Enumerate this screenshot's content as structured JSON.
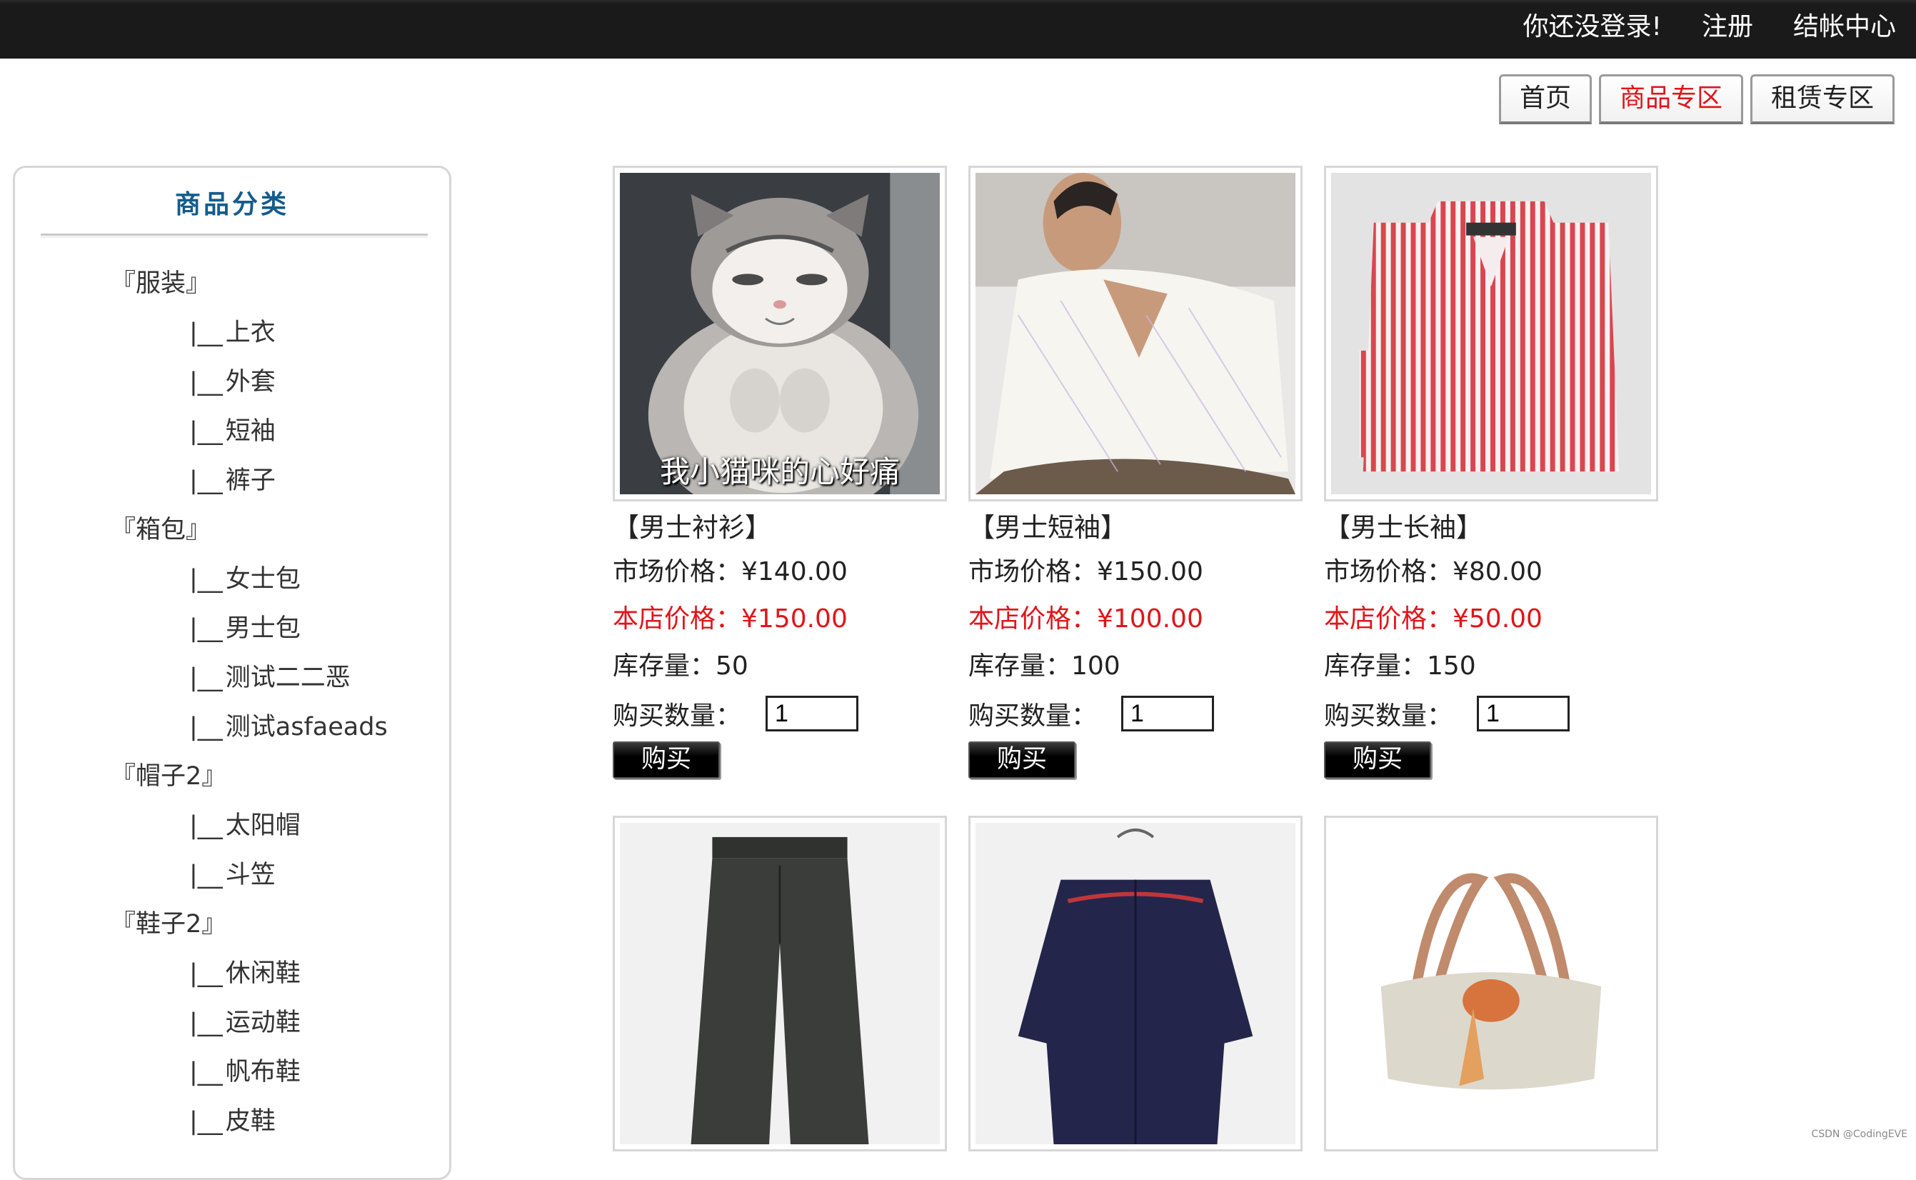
{
  "header": {
    "login_status": "你还没登录!",
    "register": "注册",
    "checkout": "结帐中心"
  },
  "tabs": [
    {
      "label": "首页",
      "active": false
    },
    {
      "label": "商品专区",
      "active": true
    },
    {
      "label": "租赁专区",
      "active": false
    }
  ],
  "sidebar": {
    "title": "商品分类",
    "categories": [
      {
        "name": "『服装』",
        "children": [
          "上衣",
          "外套",
          "短袖",
          "裤子"
        ]
      },
      {
        "name": "『箱包』",
        "children": [
          "女士包",
          "男士包",
          "测试二二恶",
          "测试asfaeads"
        ]
      },
      {
        "name": "『帽子2』",
        "children": [
          "太阳帽",
          "斗笠"
        ]
      },
      {
        "name": "『鞋子2』",
        "children": [
          "休闲鞋",
          "运动鞋",
          "帆布鞋",
          "皮鞋"
        ]
      }
    ],
    "branch_glyph": "|__"
  },
  "products": [
    {
      "name": "【男士衬衫】",
      "market": "市场价格：¥140.00",
      "store": "本店价格：¥150.00",
      "stock": "库存量：50",
      "qty_label": "购买数量：",
      "qty": "1",
      "buy": "购买",
      "image": "cat-meme",
      "image_caption": "我小猫咪的心好痛"
    },
    {
      "name": "【男士短袖】",
      "market": "市场价格：¥150.00",
      "store": "本店价格：¥100.00",
      "stock": "库存量：100",
      "qty_label": "购买数量：",
      "qty": "1",
      "buy": "购买",
      "image": "white-short-sleeve-shirt"
    },
    {
      "name": "【男士长袖】",
      "market": "市场价格：¥80.00",
      "store": "本店价格：¥50.00",
      "stock": "库存量：150",
      "qty_label": "购买数量：",
      "qty": "1",
      "buy": "购买",
      "image": "red-striped-shirt"
    },
    {
      "image": "dark-jeans"
    },
    {
      "image": "navy-long-sleeve-shirt"
    },
    {
      "image": "beige-handbag"
    }
  ],
  "watermark": "CSDN @CodingEVE",
  "colors": {
    "accent_red": "#e0151b",
    "title_blue": "#145c8c",
    "topbar": "#1a1a1a"
  }
}
